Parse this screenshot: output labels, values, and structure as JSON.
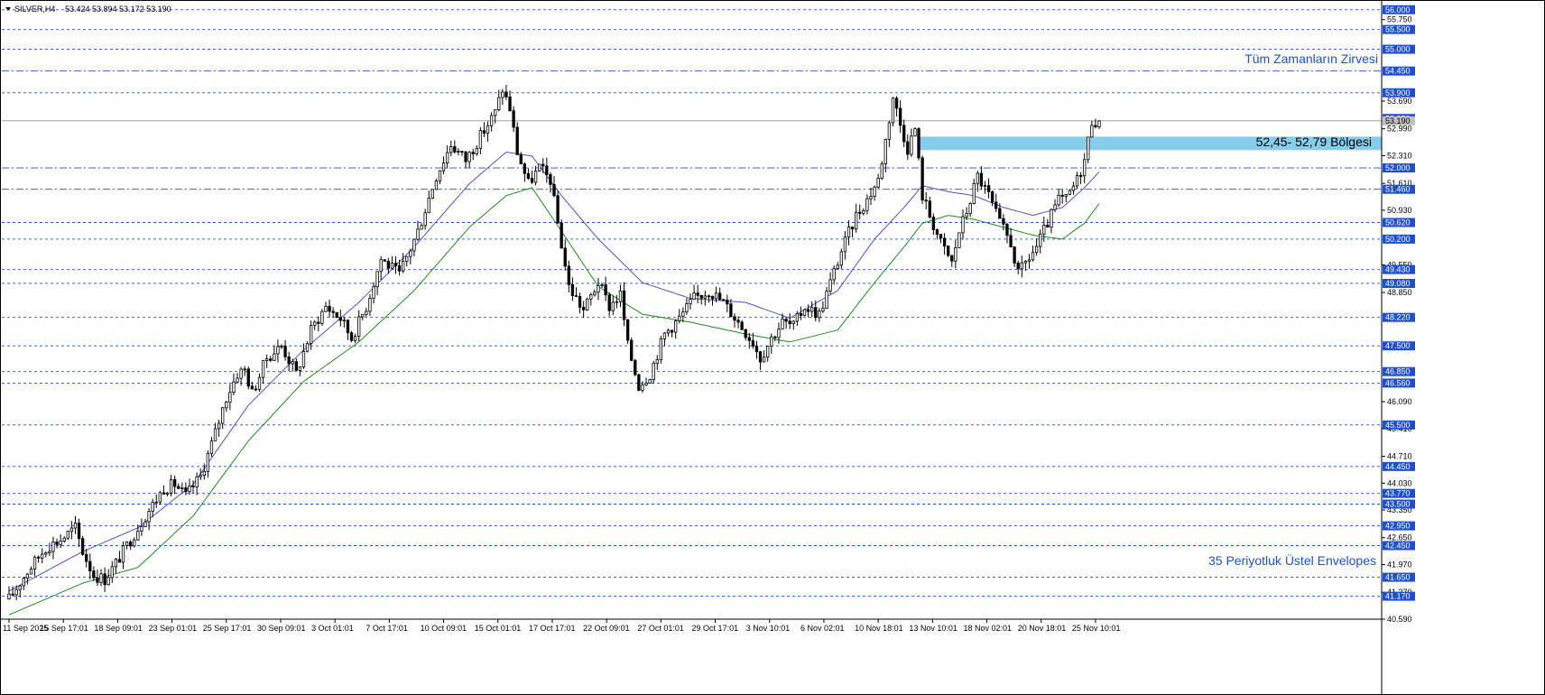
{
  "header": {
    "symbol": "SILVER,H4",
    "ohlc": "53.424 53.894 53.172 53.190"
  },
  "colors": {
    "background": "#ffffff",
    "candle": "#000000",
    "level_line": "#1f4fd1",
    "badge": "#1f4fd1",
    "upper_envelope": "#5050c8",
    "lower_envelope": "#1f8a1f",
    "zone": "#87cdeb",
    "annotation": "#1f4fd1"
  },
  "chart_data": {
    "type": "candlestick",
    "symbol": "SILVER",
    "timeframe": "H4",
    "ylim": [
      40.59,
      56.0
    ],
    "y_ticks": [
      55.75,
      53.69,
      52.99,
      52.31,
      51.61,
      50.93,
      49.55,
      48.85,
      46.09,
      45.41,
      44.71,
      44.03,
      43.35,
      42.65,
      41.97,
      41.27,
      40.59
    ],
    "level_badges": [
      56.0,
      55.5,
      55.0,
      54.45,
      53.9,
      53.25,
      52.0,
      51.46,
      50.62,
      50.2,
      49.43,
      49.08,
      48.22,
      47.5,
      46.85,
      46.56,
      45.5,
      44.45,
      43.77,
      43.5,
      42.95,
      42.45,
      41.65,
      41.17
    ],
    "dashed_levels": [
      56.0,
      55.5,
      55.0,
      53.9,
      50.62,
      50.2,
      49.43,
      49.08,
      48.22,
      47.5,
      46.85,
      46.56,
      45.5,
      44.45,
      43.77,
      43.5,
      42.95,
      42.45,
      41.65,
      41.17
    ],
    "dashdot_levels": [
      54.45,
      52.0,
      51.46
    ],
    "x_labels": [
      "11 Sep 2025",
      "15 Sep 17:01",
      "18 Sep 09:01",
      "23 Sep 01:01",
      "25 Sep 17:01",
      "30 Sep 09:01",
      "3 Oct 01:01",
      "7 Oct 17:01",
      "10 Oct 09:01",
      "15 Oct 01:01",
      "17 Oct 17:01",
      "22 Oct 09:01",
      "27 Oct 01:01",
      "29 Oct 17:01",
      "3 Nov 10:01",
      "6 Nov 02:01",
      "10 Nov 18:01",
      "13 Nov 10:01",
      "18 Nov 02:01",
      "20 Nov 18:01",
      "25 Nov 10:01"
    ],
    "zone": {
      "low": 52.45,
      "high": 52.79,
      "label": "52,45- 52,79 Bölgesi"
    },
    "annotations": {
      "all_time_high": "Tüm Zamanların Zirvesi",
      "envelopes": "35 Periyotluk Üstel Envelopes"
    },
    "last_price": 53.19,
    "price_path": [
      [
        0,
        41.1
      ],
      [
        5,
        41.8
      ],
      [
        10,
        42.4
      ],
      [
        14,
        42.6
      ],
      [
        18,
        42.9
      ],
      [
        20,
        42.3
      ],
      [
        23,
        41.7
      ],
      [
        26,
        41.6
      ],
      [
        29,
        42.0
      ],
      [
        33,
        42.6
      ],
      [
        37,
        43.2
      ],
      [
        42,
        43.9
      ],
      [
        45,
        44.0
      ],
      [
        48,
        43.7
      ],
      [
        52,
        44.2
      ],
      [
        56,
        45.3
      ],
      [
        59,
        46.2
      ],
      [
        62,
        46.8
      ],
      [
        64,
        46.9
      ],
      [
        66,
        46.3
      ],
      [
        70,
        47.2
      ],
      [
        74,
        47.5
      ],
      [
        78,
        46.8
      ],
      [
        82,
        47.9
      ],
      [
        86,
        48.5
      ],
      [
        90,
        48.2
      ],
      [
        93,
        47.7
      ],
      [
        97,
        48.5
      ],
      [
        101,
        49.7
      ],
      [
        106,
        49.3
      ],
      [
        111,
        50.4
      ],
      [
        116,
        51.8
      ],
      [
        120,
        52.6
      ],
      [
        124,
        52.2
      ],
      [
        128,
        52.8
      ],
      [
        132,
        53.4
      ],
      [
        134,
        54.0
      ],
      [
        136,
        53.5
      ],
      [
        138,
        52.4
      ],
      [
        141,
        51.6
      ],
      [
        144,
        52.0
      ],
      [
        147,
        51.7
      ],
      [
        149,
        50.6
      ],
      [
        152,
        49.0
      ],
      [
        156,
        48.4
      ],
      [
        160,
        49.1
      ],
      [
        163,
        48.5
      ],
      [
        166,
        48.8
      ],
      [
        168,
        47.5
      ],
      [
        171,
        46.5
      ],
      [
        174,
        46.8
      ],
      [
        178,
        47.8
      ],
      [
        182,
        48.2
      ],
      [
        186,
        48.7
      ],
      [
        190,
        48.9
      ],
      [
        194,
        48.6
      ],
      [
        198,
        48.1
      ],
      [
        202,
        47.6
      ],
      [
        204,
        47.2
      ],
      [
        207,
        47.7
      ],
      [
        210,
        48.1
      ],
      [
        213,
        48.0
      ],
      [
        216,
        48.5
      ],
      [
        220,
        48.3
      ],
      [
        223,
        49.1
      ],
      [
        226,
        49.9
      ],
      [
        230,
        50.8
      ],
      [
        233,
        51.2
      ],
      [
        236,
        51.7
      ],
      [
        238,
        52.7
      ],
      [
        240,
        53.8
      ],
      [
        242,
        53.1
      ],
      [
        244,
        52.5
      ],
      [
        246,
        53.0
      ],
      [
        248,
        51.3
      ],
      [
        250,
        50.8
      ],
      [
        253,
        50.1
      ],
      [
        256,
        49.6
      ],
      [
        258,
        50.4
      ],
      [
        260,
        50.9
      ],
      [
        263,
        51.8
      ],
      [
        266,
        51.3
      ],
      [
        269,
        50.6
      ],
      [
        272,
        50.1
      ],
      [
        274,
        49.3
      ],
      [
        276,
        49.6
      ],
      [
        279,
        50.0
      ],
      [
        282,
        50.6
      ],
      [
        285,
        51.2
      ],
      [
        287,
        51.2
      ],
      [
        290,
        51.7
      ],
      [
        292,
        52.2
      ],
      [
        294,
        53.2
      ],
      [
        296,
        53.19
      ]
    ],
    "upper_envelope": [
      [
        0,
        41.3
      ],
      [
        20,
        42.3
      ],
      [
        35,
        42.9
      ],
      [
        50,
        44.0
      ],
      [
        65,
        46.0
      ],
      [
        80,
        47.4
      ],
      [
        95,
        48.6
      ],
      [
        110,
        50.0
      ],
      [
        125,
        51.6
      ],
      [
        135,
        52.4
      ],
      [
        142,
        52.3
      ],
      [
        150,
        51.3
      ],
      [
        160,
        50.2
      ],
      [
        172,
        49.1
      ],
      [
        185,
        48.7
      ],
      [
        200,
        48.6
      ],
      [
        212,
        48.2
      ],
      [
        225,
        48.9
      ],
      [
        235,
        50.2
      ],
      [
        243,
        51.0
      ],
      [
        248,
        51.55
      ],
      [
        255,
        51.4
      ],
      [
        262,
        51.3
      ],
      [
        270,
        51.0
      ],
      [
        278,
        50.8
      ],
      [
        286,
        51.0
      ],
      [
        292,
        51.5
      ],
      [
        296,
        51.9
      ]
    ],
    "lower_envelope": [
      [
        0,
        40.7
      ],
      [
        20,
        41.5
      ],
      [
        35,
        41.9
      ],
      [
        50,
        43.2
      ],
      [
        65,
        45.1
      ],
      [
        80,
        46.6
      ],
      [
        95,
        47.6
      ],
      [
        110,
        48.9
      ],
      [
        125,
        50.5
      ],
      [
        135,
        51.3
      ],
      [
        142,
        51.5
      ],
      [
        150,
        50.4
      ],
      [
        160,
        49.0
      ],
      [
        172,
        48.3
      ],
      [
        185,
        48.1
      ],
      [
        200,
        47.8
      ],
      [
        212,
        47.6
      ],
      [
        225,
        47.9
      ],
      [
        235,
        49.1
      ],
      [
        243,
        50.0
      ],
      [
        248,
        50.6
      ],
      [
        255,
        50.8
      ],
      [
        262,
        50.7
      ],
      [
        270,
        50.5
      ],
      [
        278,
        50.3
      ],
      [
        286,
        50.2
      ],
      [
        292,
        50.6
      ],
      [
        296,
        51.1
      ]
    ]
  }
}
